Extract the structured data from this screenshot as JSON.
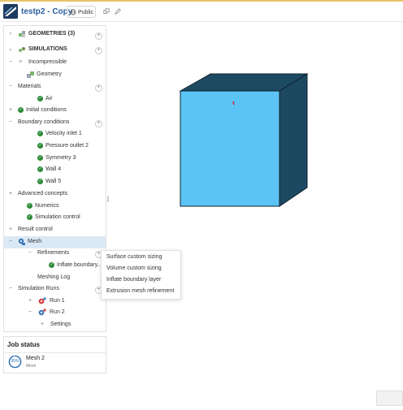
{
  "topbar": {
    "project_title": "testp2 - Copy",
    "public_label": "Public",
    "copy_icon": "copy-icon",
    "edit_icon": "pencil-icon"
  },
  "tree": {
    "geometries": "GEOMETRIES (3)",
    "simulations": "SIMULATIONS",
    "incompressible": "Incompressible",
    "geometry": "Geometry",
    "materials": "Materials",
    "air": "Air",
    "initial_conditions": "Initial conditions",
    "boundary_conditions": "Boundary conditions",
    "bc_items": [
      "Velocity inlet 1",
      "Pressure outlet 2",
      "Symmetry 3",
      "Wall 4",
      "Wall 5"
    ],
    "advanced_concepts": "Advanced concepts",
    "numerics": "Numerics",
    "simulation_control": "Simulation control",
    "result_control": "Result control",
    "mesh": "Mesh",
    "refinements": "Refinements",
    "inflate_boundary": "Inflate boundary...",
    "meshing_log": "Meshing Log",
    "simulation_runs": "Simulation Runs",
    "run1": "Run 1",
    "run2": "Run 2",
    "settings": "Settings"
  },
  "context_menu": {
    "items": [
      "Surface custom sizing",
      "Volume custom sizing",
      "Inflate boundary layer",
      "Extrusion mesh refinement"
    ]
  },
  "job_status": {
    "title": "Job status",
    "progress_label": "95%",
    "progress": 0.95,
    "name": "Mesh 2",
    "subtitle": "Mesh"
  },
  "colors": {
    "accent": "#2a5d9f",
    "check": "#2e8b3a",
    "box_front": "#5bc4f5",
    "box_side": "#1c4862",
    "selection": "#dbe9f6"
  }
}
